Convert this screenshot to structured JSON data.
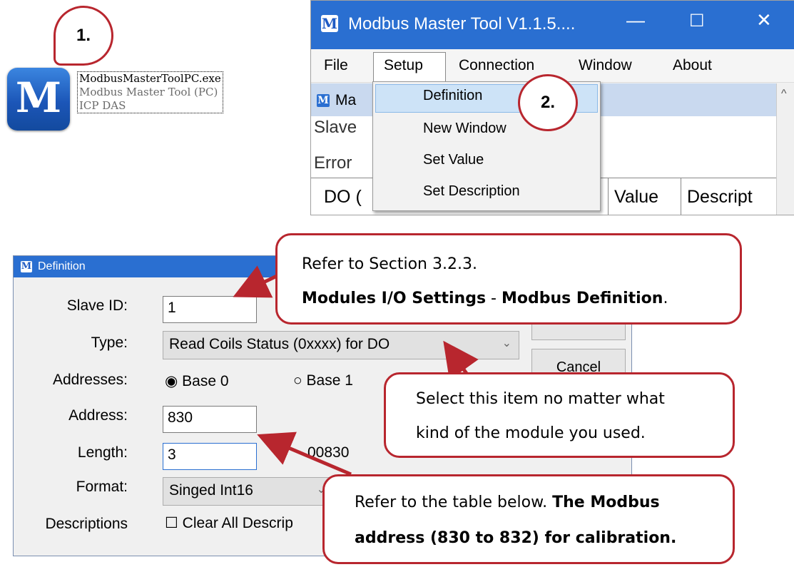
{
  "callouts": {
    "step1": "1.",
    "step2": "2.",
    "refer_section": {
      "line1": "Refer to Section 3.2.3.",
      "line2_bold_a": "Modules I/O Settings",
      "line2_sep": " - ",
      "line2_bold_b": "Modbus Definition",
      "line2_end": "."
    },
    "select_item": {
      "line1": "Select this item no matter what",
      "line2": "kind of the module you used."
    },
    "refer_table": {
      "line1_plain": "Refer to the table below. ",
      "line1_bold": "The Modbus",
      "line2_bold": "address (830 to 832) for calibration."
    }
  },
  "exe_file": {
    "icon_letter": "M",
    "name": "ModbusMasterToolPC.exe",
    "description": "Modbus Master Tool (PC)",
    "company": "ICP DAS"
  },
  "modbus_window": {
    "title": "Modbus Master Tool V1.1.5....",
    "logo": "M",
    "controls": {
      "minimize": "—",
      "maximize": "☐",
      "close": "✕"
    },
    "menu": [
      "File",
      "Setup",
      "Connection",
      "Window",
      "About"
    ],
    "child_title": "Ma",
    "child_labels": [
      "Slave",
      "Error"
    ],
    "grid_headers": [
      "DO (",
      "Value",
      "Descript"
    ],
    "dropdown": [
      "Definition",
      "New Window",
      "Set Value",
      "Set Description"
    ],
    "scroll_up": "^"
  },
  "definition_dialog": {
    "title": "Definition",
    "logo": "M",
    "labels": {
      "slave_id": "Slave ID:",
      "type": "Type:",
      "addresses": "Addresses:",
      "address": "Address:",
      "length": "Length:",
      "format": "Format:",
      "descriptions": "Descriptions"
    },
    "values": {
      "slave_id": "1",
      "type": "Read Coils Status (0xxxx) for DO",
      "base0": "Base 0",
      "base1": "Base 1",
      "address": "830",
      "length": "3",
      "address_display": "00830",
      "format": "Singed Int16",
      "clear_all": "Clear All Descrip"
    },
    "buttons": {
      "cancel": "Cancel"
    },
    "radio_symbols": {
      "checked": "◉",
      "unchecked": "○"
    },
    "checkbox_symbol": "☐",
    "chevron": "⌄"
  }
}
